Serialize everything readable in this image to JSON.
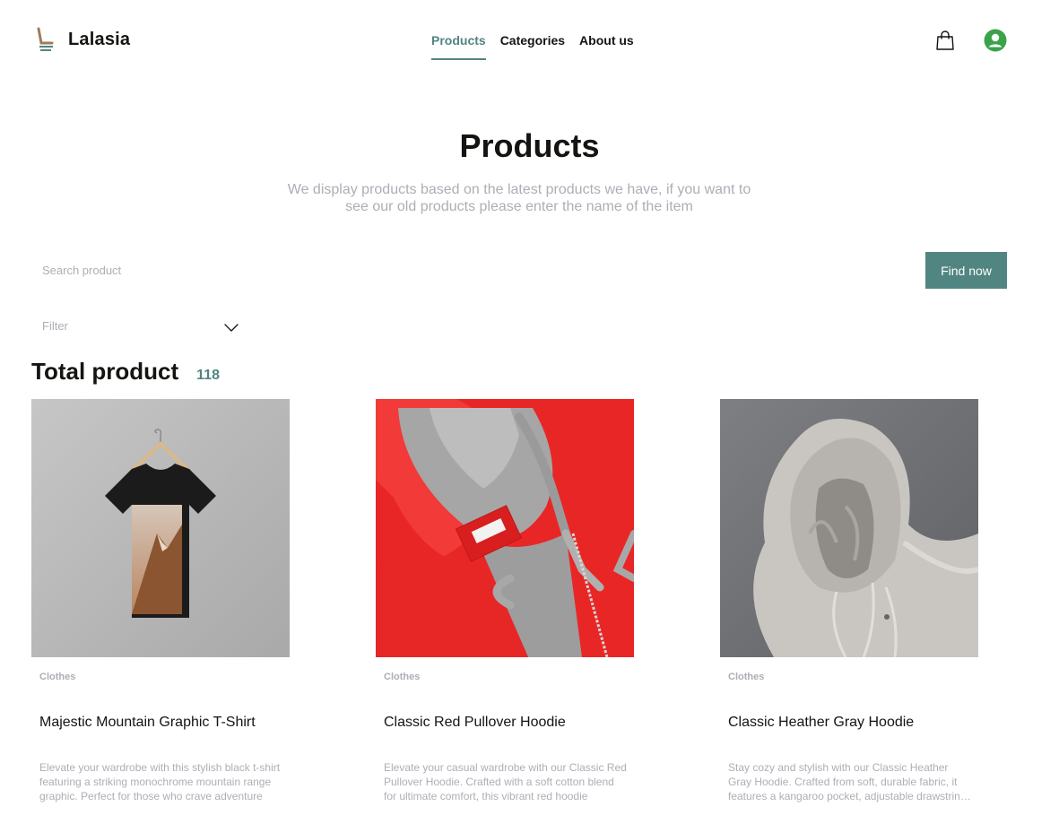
{
  "brand": {
    "name": "Lalasia"
  },
  "nav": {
    "items": [
      {
        "label": "Products",
        "active": true
      },
      {
        "label": "Categories",
        "active": false
      },
      {
        "label": "About us",
        "active": false
      }
    ]
  },
  "header_icons": {
    "cart": "shopping-bag-icon",
    "user": "user-avatar-icon"
  },
  "hero": {
    "title": "Products",
    "subtitle": "We display products based on the latest products we have, if you want to see our old products please enter the name of the item"
  },
  "search": {
    "placeholder": "Search product",
    "value": "",
    "button_label": "Find now"
  },
  "filter": {
    "label": "Filter"
  },
  "total": {
    "label": "Total product",
    "count": "118"
  },
  "products": [
    {
      "category": "Clothes",
      "title": "Majestic Mountain Graphic T-Shirt",
      "description": "Elevate your wardrobe with this stylish black t-shirt featuring a striking monochrome mountain range graphic. Perfect for those who crave adventure"
    },
    {
      "category": "Clothes",
      "title": "Classic Red Pullover Hoodie",
      "description": "Elevate your casual wardrobe with our Classic Red Pullover Hoodie. Crafted with a soft cotton blend for ultimate comfort, this vibrant red hoodie"
    },
    {
      "category": "Clothes",
      "title": "Classic Heather Gray Hoodie",
      "description": "Stay cozy and stylish with our Classic Heather Gray Hoodie. Crafted from soft, durable fabric, it features a kangaroo pocket, adjustable drawstring hood"
    }
  ],
  "colors": {
    "accent": "#518581",
    "text": "#151411",
    "muted": "#afadb5"
  }
}
